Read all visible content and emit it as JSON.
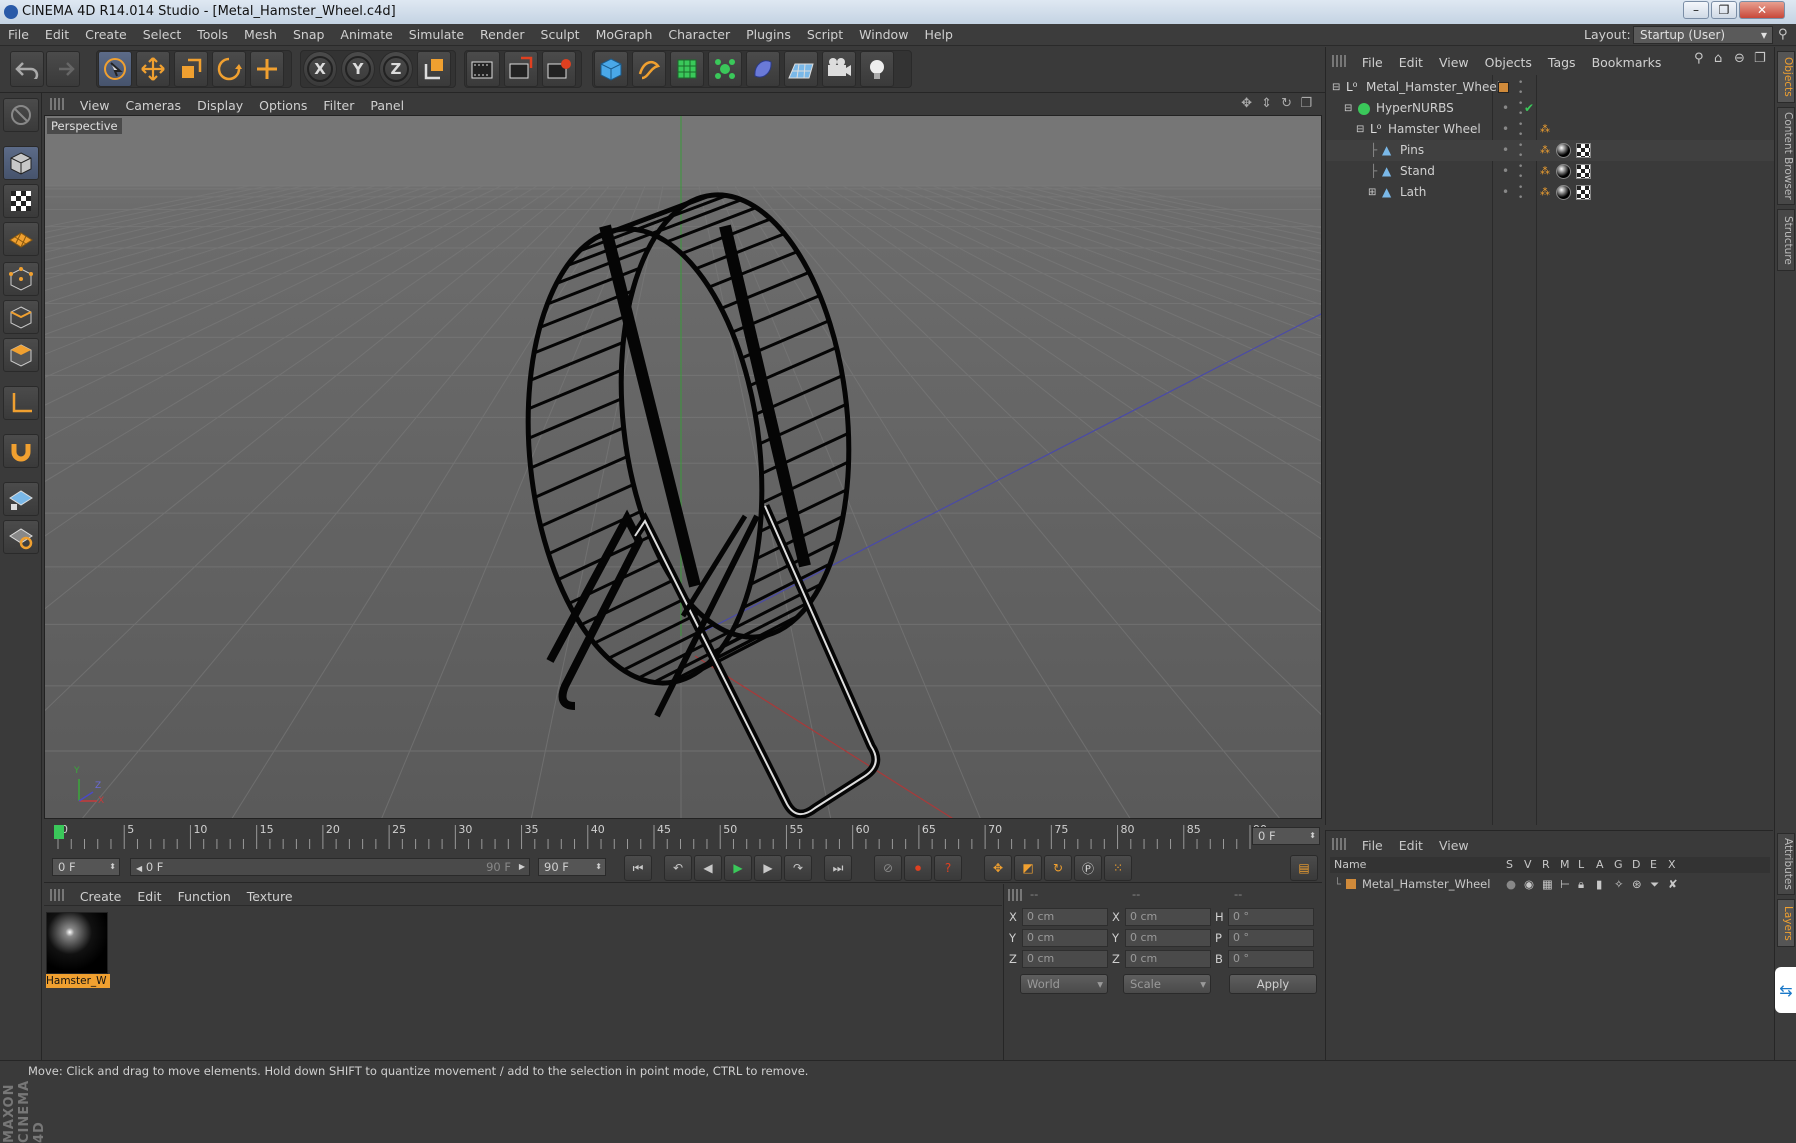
{
  "window": {
    "title": "CINEMA 4D R14.014 Studio - [Metal_Hamster_Wheel.c4d]",
    "buttons": {
      "minimize": "–",
      "maximize": "❐",
      "close": "✕"
    }
  },
  "menubar": {
    "items": [
      "File",
      "Edit",
      "Create",
      "Select",
      "Tools",
      "Mesh",
      "Snap",
      "Animate",
      "Simulate",
      "Render",
      "Sculpt",
      "MoGraph",
      "Character",
      "Plugins",
      "Script",
      "Window",
      "Help"
    ],
    "layout_label": "Layout:",
    "layout_value": "Startup (User)"
  },
  "axis_buttons": {
    "x": "X",
    "y": "Y",
    "z": "Z"
  },
  "viewport": {
    "menu": [
      "View",
      "Cameras",
      "Display",
      "Options",
      "Filter",
      "Panel"
    ],
    "label": "Perspective",
    "axis_labels": {
      "x": "X",
      "y": "Y",
      "z": "Z"
    }
  },
  "timeline": {
    "ticks": [
      "0",
      "5",
      "10",
      "15",
      "20",
      "25",
      "30",
      "35",
      "40",
      "45",
      "50",
      "55",
      "60",
      "65",
      "70",
      "75",
      "80",
      "85",
      "90"
    ],
    "current_frame": "0 F"
  },
  "transport": {
    "start_field": "0 F",
    "range_start": "0 F",
    "range_end": "90 F",
    "end_field": "90 F"
  },
  "material_manager": {
    "menu": [
      "Create",
      "Edit",
      "Function",
      "Texture"
    ],
    "materials": [
      {
        "name": "Hamster_W"
      }
    ]
  },
  "coordinates": {
    "header": [
      "--",
      "--",
      "--"
    ],
    "rows": [
      {
        "l1": "X",
        "v1": "0 cm",
        "l2": "X",
        "v2": "0 cm",
        "l3": "H",
        "v3": "0 °"
      },
      {
        "l1": "Y",
        "v1": "0 cm",
        "l2": "Y",
        "v2": "0 cm",
        "l3": "P",
        "v3": "0 °"
      },
      {
        "l1": "Z",
        "v1": "0 cm",
        "l2": "Z",
        "v2": "0 cm",
        "l3": "B",
        "v3": "0 °"
      }
    ],
    "mode_select": "World",
    "type_select": "Scale",
    "apply": "Apply"
  },
  "object_manager": {
    "menu": [
      "File",
      "Edit",
      "View",
      "Objects",
      "Tags",
      "Bookmarks"
    ],
    "objects": [
      {
        "name": "Metal_Hamster_Wheel",
        "indent": 0
      },
      {
        "name": "HyperNURBS",
        "indent": 1
      },
      {
        "name": "Hamster Wheel",
        "indent": 2
      },
      {
        "name": "Pins",
        "indent": 3
      },
      {
        "name": "Stand",
        "indent": 3
      },
      {
        "name": "Lath",
        "indent": 3
      }
    ]
  },
  "layers": {
    "menu": [
      "File",
      "Edit",
      "View"
    ],
    "columns": [
      "Name",
      "S",
      "V",
      "R",
      "M",
      "L",
      "A",
      "G",
      "D",
      "E",
      "X"
    ],
    "rows": [
      {
        "name": "Metal_Hamster_Wheel"
      }
    ]
  },
  "side_tabs": [
    "Objects",
    "Content Browser",
    "Structure",
    "Attributes",
    "Layers"
  ],
  "status": "Move: Click and drag to move elements. Hold down SHIFT to quantize movement / add to the selection in point mode, CTRL to remove.",
  "colors": {
    "accent": "#f0a030",
    "selected": "#5c6b88",
    "viewport_bg": "#6a6a6a"
  }
}
